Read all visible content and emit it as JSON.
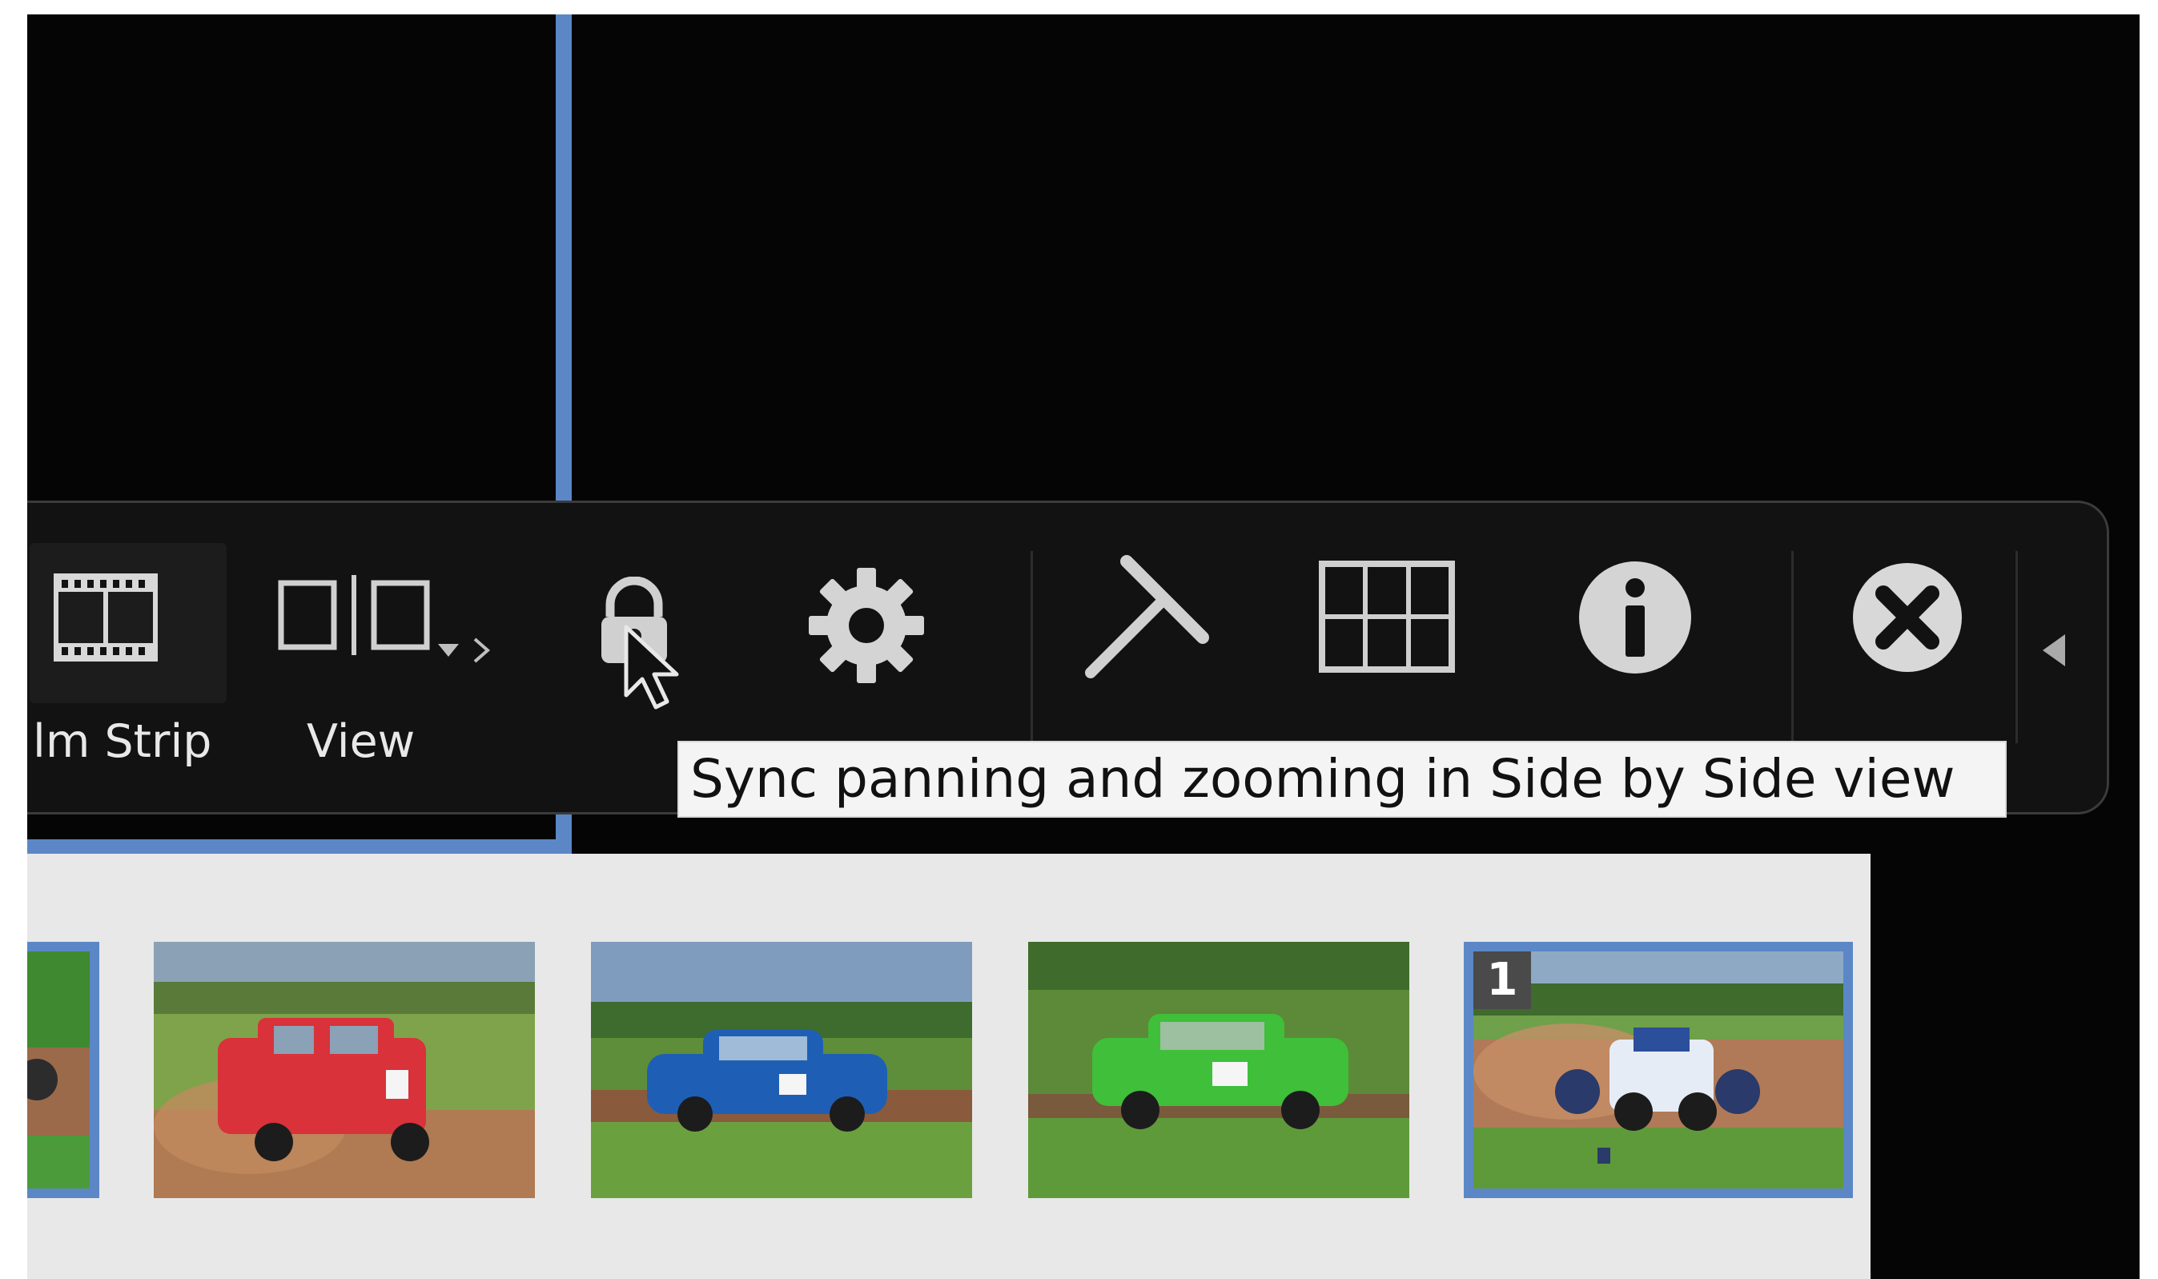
{
  "toolbar": {
    "film_strip_label": "lm Strip",
    "view_label": "View",
    "tooltip": "Sync panning and zooming in Side by Side view"
  },
  "icons": {
    "film_strip": "film-strip-icon",
    "side_by_side": "side-by-side-view-icon",
    "view_dropdown": "chevron-down-icon",
    "view_next": "chevron-right-icon",
    "lock": "lock-icon",
    "settings": "gear-icon",
    "squeegee": "squeegee-icon",
    "grid": "grid-icon",
    "info": "info-icon",
    "close": "close-icon",
    "collapse": "triangle-left-icon"
  },
  "colors": {
    "selection": "#5b87c7",
    "background": "#050505",
    "toolbar": "#121212",
    "filmstrip_bg": "#e8e8e8"
  },
  "filmstrip": {
    "thumbnails": [
      {
        "id": "partial",
        "selected": true,
        "badge": ""
      },
      {
        "id": "red-car",
        "selected": false,
        "badge": ""
      },
      {
        "id": "blue-car",
        "selected": false,
        "badge": ""
      },
      {
        "id": "green-car",
        "selected": false,
        "badge": ""
      },
      {
        "id": "buggy",
        "selected": true,
        "badge": "1"
      }
    ]
  }
}
